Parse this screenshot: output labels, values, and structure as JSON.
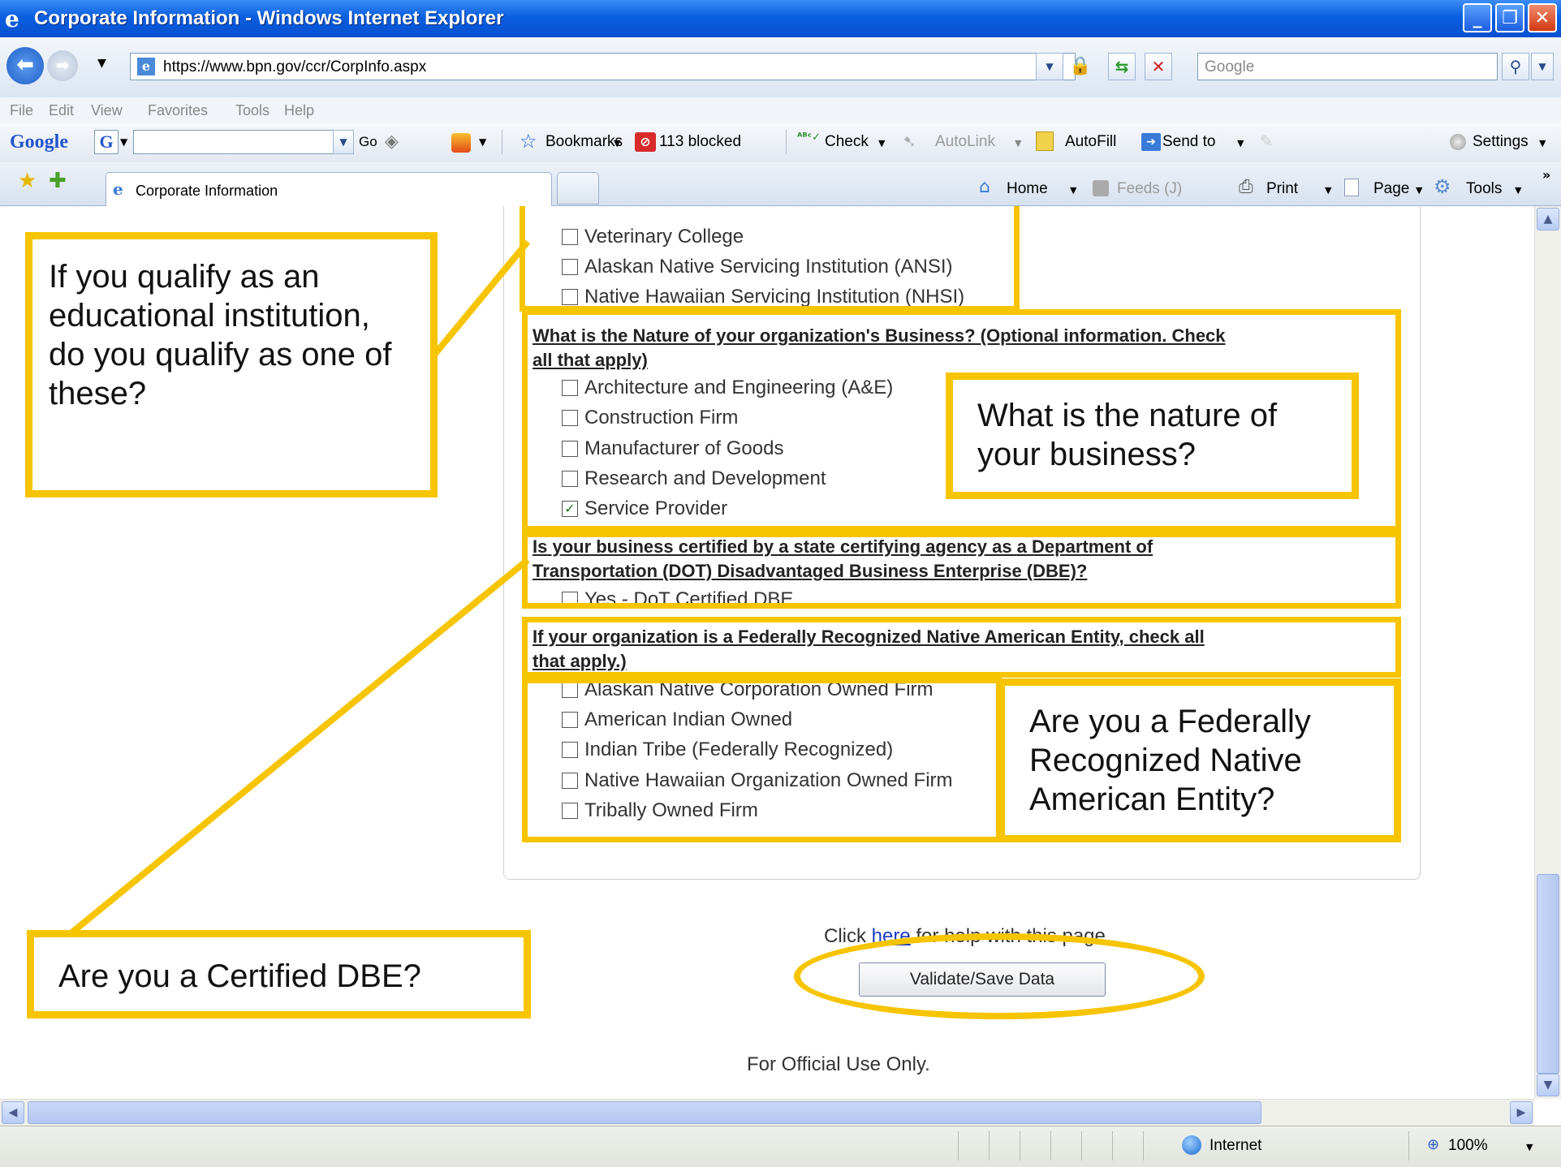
{
  "window": {
    "title": "Corporate Information - Windows Internet Explorer"
  },
  "address_bar": {
    "url": "https://www.bpn.gov/ccr/CorpInfo.aspx",
    "search_placeholder": "Google"
  },
  "menu": [
    "File",
    "Edit",
    "View",
    "Favorites",
    "Tools",
    "Help"
  ],
  "google_toolbar": {
    "brand": "Google",
    "g_button": "G",
    "go_label": "Go",
    "bookmarks_label": "Bookmarks",
    "blocked_label": "113 blocked",
    "check_label": "Check",
    "autolink_label": "AutoLink",
    "autofill_label": "AutoFill",
    "sendto_label": "Send to",
    "settings_label": "Settings"
  },
  "tabs": {
    "active_tab_label": "Corporate Information"
  },
  "command_bar": {
    "home_label": "Home",
    "feeds_label": "Feeds (J)",
    "print_label": "Print",
    "page_label": "Page",
    "tools_label": "Tools"
  },
  "form": {
    "education_options": [
      {
        "label": "Veterinary College",
        "checked": false
      },
      {
        "label": "Alaskan Native Servicing Institution (ANSI)",
        "checked": false
      },
      {
        "label": "Native Hawaiian Servicing Institution (NHSI)",
        "checked": false
      }
    ],
    "nature_question_line1": "What is the Nature of your organization's Business? (Optional information. Check",
    "nature_question_line2": "all that apply)",
    "nature_options": [
      {
        "label": "Architecture and Engineering (A&E)",
        "checked": false
      },
      {
        "label": "Construction Firm",
        "checked": false
      },
      {
        "label": "Manufacturer of Goods",
        "checked": false
      },
      {
        "label": "Research and Development",
        "checked": false
      },
      {
        "label": "Service Provider",
        "checked": true
      }
    ],
    "dbe_question_line1": "Is your business certified by a state certifying agency as a Department of",
    "dbe_question_line2": "Transportation (DOT) Disadvantaged Business Enterprise (DBE)?",
    "dbe_options": [
      {
        "label": "Yes - DoT Certified DBE",
        "checked": false
      }
    ],
    "native_question_line1": "If your organization is a Federally Recognized Native American Entity, check all",
    "native_question_line2": "that apply.)",
    "native_options": [
      {
        "label": "Alaskan Native Corporation Owned Firm",
        "checked": false
      },
      {
        "label": "American Indian Owned",
        "checked": false
      },
      {
        "label": "Indian Tribe (Federally Recognized)",
        "checked": false
      },
      {
        "label": "Native Hawaiian Organization Owned Firm",
        "checked": false
      },
      {
        "label": "Tribally Owned Firm",
        "checked": false
      }
    ],
    "help_prefix": "Click",
    "help_link": "here",
    "help_suffix": "for help with this page",
    "validate_button": "Validate/Save Data",
    "footer": "For Official Use Only."
  },
  "callouts": {
    "education": "If you qualify as an educational institution, do you qualify as one of these?",
    "nature": "What is the nature of your business?",
    "native": "Are you a Federally Recognized Native American Entity?",
    "dbe": "Are you a Certified DBE?"
  },
  "status_bar": {
    "zone": "Internet",
    "zoom": "100%"
  },
  "colors": {
    "annotation": "#f7c400",
    "titlebar": "#0a5fe0"
  }
}
